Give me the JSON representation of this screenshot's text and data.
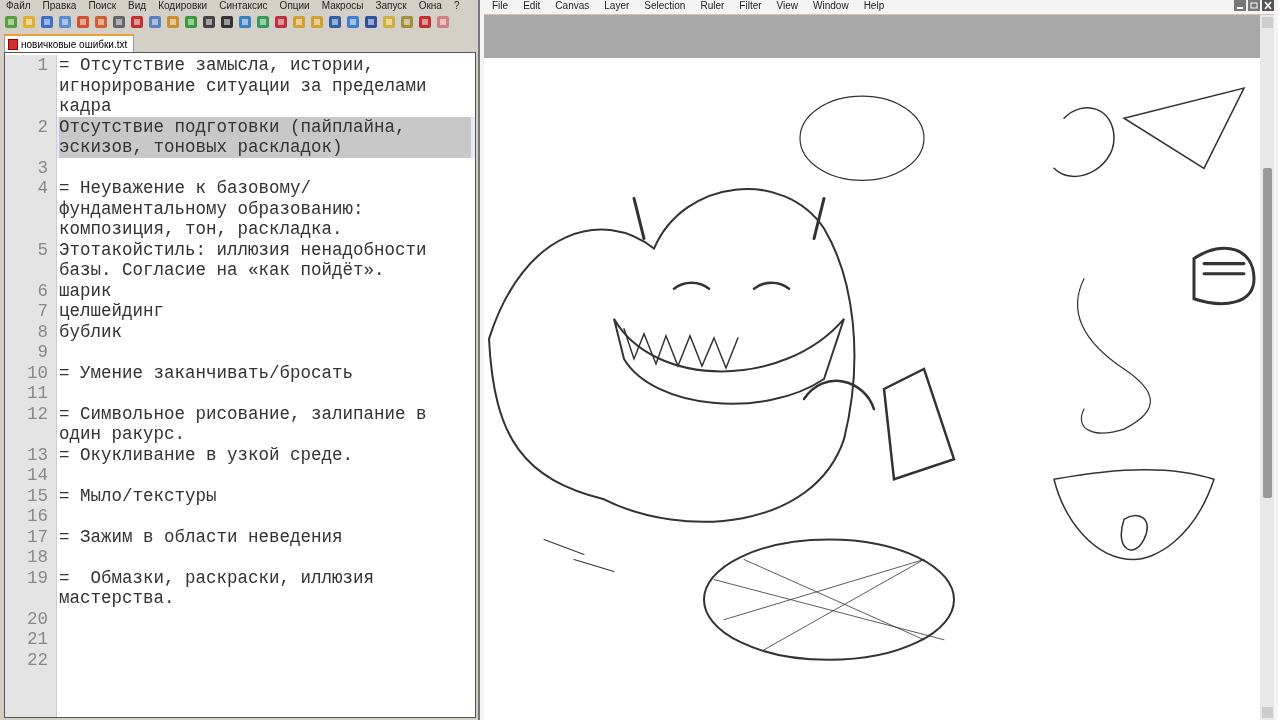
{
  "editor": {
    "menu": [
      "Файл",
      "Правка",
      "Поиск",
      "Вид",
      "Кодировки",
      "Синтаксис",
      "Опции",
      "Макросы",
      "Запуск",
      "Окна",
      "?"
    ],
    "tabs": [
      {
        "label": "новичковые ошибки.txt",
        "selected": true
      }
    ],
    "lines": [
      {
        "number": "1",
        "text": "= Отсутствие замысла, истории, игнорирование ситуации за пределами кадра",
        "selected": false
      },
      {
        "number": "2",
        "text": "Отсутствие подготовки (пайплайна, эскизов, тоновых раскладок)",
        "selected": true
      },
      {
        "number": "3",
        "selected": false
      },
      {
        "number": "4",
        "text": "= Неуважение к базовому/фундаментальному образованию: композиция, тон, раскладка.",
        "selected": false
      },
      {
        "number": "5",
        "text": "Этотакойстиль: иллюзия ненадобности базы. Согласие на «как пойдёт».",
        "selected": false
      },
      {
        "number": "6",
        "text": "шарик",
        "selected": false
      },
      {
        "number": "7",
        "text": "целшейдинг",
        "selected": false
      },
      {
        "number": "8",
        "text": "бублик",
        "selected": false
      },
      {
        "number": "9",
        "selected": false
      },
      {
        "number": "10",
        "text": "= Умение заканчивать/бросать",
        "selected": false
      },
      {
        "number": "11",
        "selected": false
      },
      {
        "number": "12",
        "text": "= Символьное рисование, залипание в один ракурс.",
        "selected": false
      },
      {
        "number": "13",
        "text": "= Окукливание в узкой среде.",
        "selected": false
      },
      {
        "number": "14",
        "selected": false
      },
      {
        "number": "15",
        "text": "= Мыло/текстуры",
        "selected": false
      },
      {
        "number": "16",
        "selected": false
      },
      {
        "number": "17",
        "text": "= Зажим в области неведения",
        "selected": false
      },
      {
        "number": "18",
        "selected": false
      },
      {
        "number": "19",
        "text": "=  Обмазки, раскраски, иллюзия мастерства.",
        "selected": false
      },
      {
        "number": "20",
        "selected": false
      },
      {
        "number": "21",
        "selected": false
      },
      {
        "number": "22",
        "selected": false
      }
    ]
  },
  "paint": {
    "menu": [
      "File",
      "Edit",
      "Canvas",
      "Layer",
      "Selection",
      "Ruler",
      "Filter",
      "View",
      "Window",
      "Help"
    ]
  }
}
